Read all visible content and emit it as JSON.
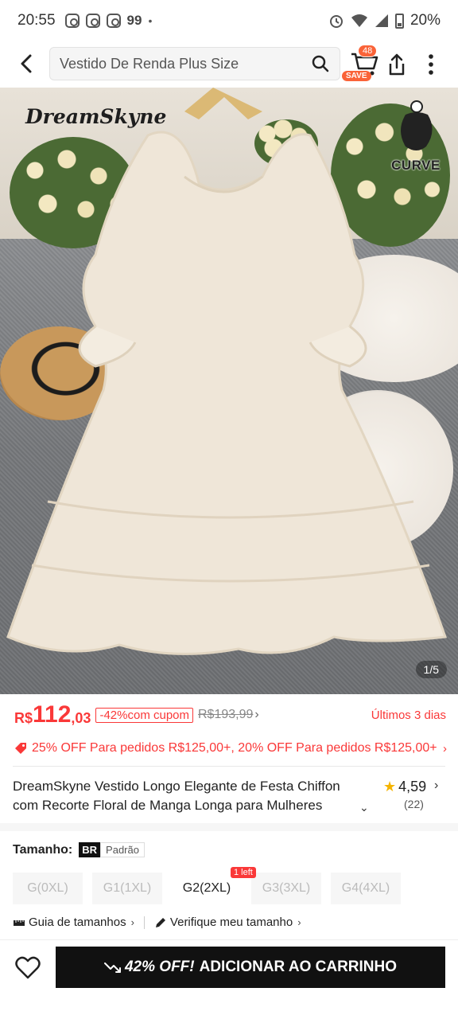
{
  "status_bar": {
    "time": "20:55",
    "notif_badge": "99",
    "dot": "•",
    "battery": "20%"
  },
  "header": {
    "search_value": "Vestido De Renda Plus Size",
    "cart_count": "48",
    "save_label": "SAVE"
  },
  "gallery": {
    "brand_logo": "DreamSkyne",
    "curve_logo": "CURVE",
    "counter": "1/5"
  },
  "price": {
    "currency": "R$",
    "integer": "112",
    "decimal": ",03",
    "discount_label": "-42%com cupom",
    "old_price": "R$193,99",
    "old_chevron": "›",
    "days_label": "Últimos 3 dias"
  },
  "promo": {
    "text": "25% OFF Para pedidos R$125,00+,  20% OFF Para pedidos R$125,00+",
    "chevron": "›"
  },
  "product": {
    "title": "DreamSkyne Vestido Longo Elegante de Festa Chiffon com Recorte Floral de Manga Longa para Mulheres",
    "expand_chevron": "⌄",
    "rating": "4,59",
    "rating_chevron": "›",
    "review_count": "(22)"
  },
  "size": {
    "label": "Tamanho:",
    "region": "BR",
    "standard": "Padrão",
    "options": [
      "G(0XL)",
      "G1(1XL)",
      "G2(2XL)",
      "G3(3XL)",
      "G4(4XL)"
    ],
    "selected_index": 2,
    "stock_badge": "1 left"
  },
  "guides": {
    "size_guide": "Guia de tamanhos",
    "verify": "Verifique meu tamanho",
    "chevron": "›"
  },
  "bottom": {
    "discount_text": "42% OFF!",
    "cta_label": "ADICIONAR AO CARRINHO"
  },
  "colors": {
    "accent_red": "#fa3838",
    "badge_orange": "#fa6338",
    "star": "#f5b400",
    "cta_bg": "#111111"
  }
}
